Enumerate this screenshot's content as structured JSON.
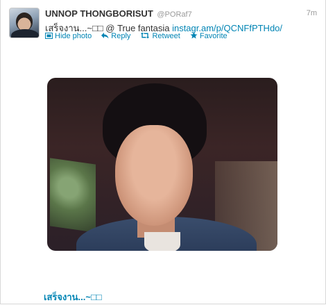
{
  "tweet": {
    "display_name": "UNNOP THONGBORISUT",
    "screen_name": "@PORaf7",
    "time": "7m",
    "text_main": "เสร็จงาน...~□□ @ True fantasia ",
    "text_link": "instagr.am/p/QCNFfPTHdo/",
    "actions": {
      "hide_photo": "Hide photo",
      "reply": "Reply",
      "retweet": "Retweet",
      "favorite": "Favorite"
    }
  },
  "media": {
    "caption": "เสร็จงาน...~□□"
  },
  "colors": {
    "link": "#0084b4",
    "muted": "#999999",
    "text": "#333333"
  }
}
